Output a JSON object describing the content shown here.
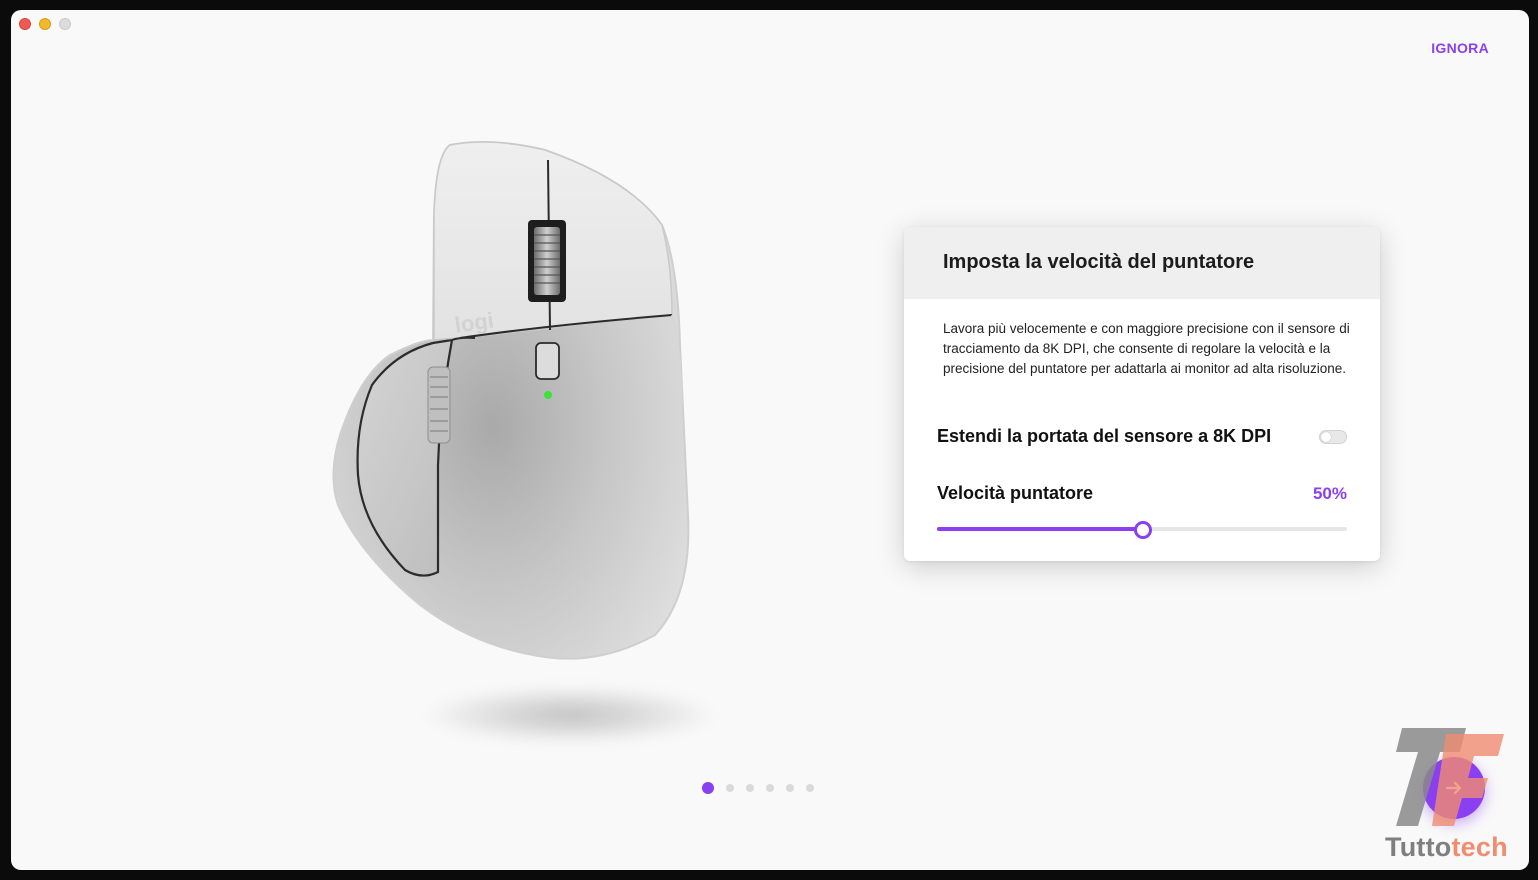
{
  "header": {
    "skip_label": "IGNORA"
  },
  "mouse": {
    "brand_text": "logi"
  },
  "card": {
    "title": "Imposta la velocità del puntatore",
    "description": "Lavora più velocemente e con maggiore precisione con il sensore di tracciamento da 8K DPI, che consente di regolare la velocità e la precisione del puntatore per adattarla ai monitor ad alta risoluzione.",
    "toggle_label": "Estendi la portata del sensore a 8K DPI",
    "toggle_on": false,
    "speed_label": "Velocità puntatore",
    "speed_value_text": "50%",
    "speed_value": 0.5
  },
  "pagination": {
    "total": 6,
    "active": 0
  },
  "watermark": {
    "part1": "Tutto",
    "part2": "tech"
  },
  "colors": {
    "accent": "#8a3ff1",
    "led": "#3ee03a",
    "watermark_orange": "#f08c70"
  },
  "icons": {
    "next": "arrow-right-icon"
  }
}
